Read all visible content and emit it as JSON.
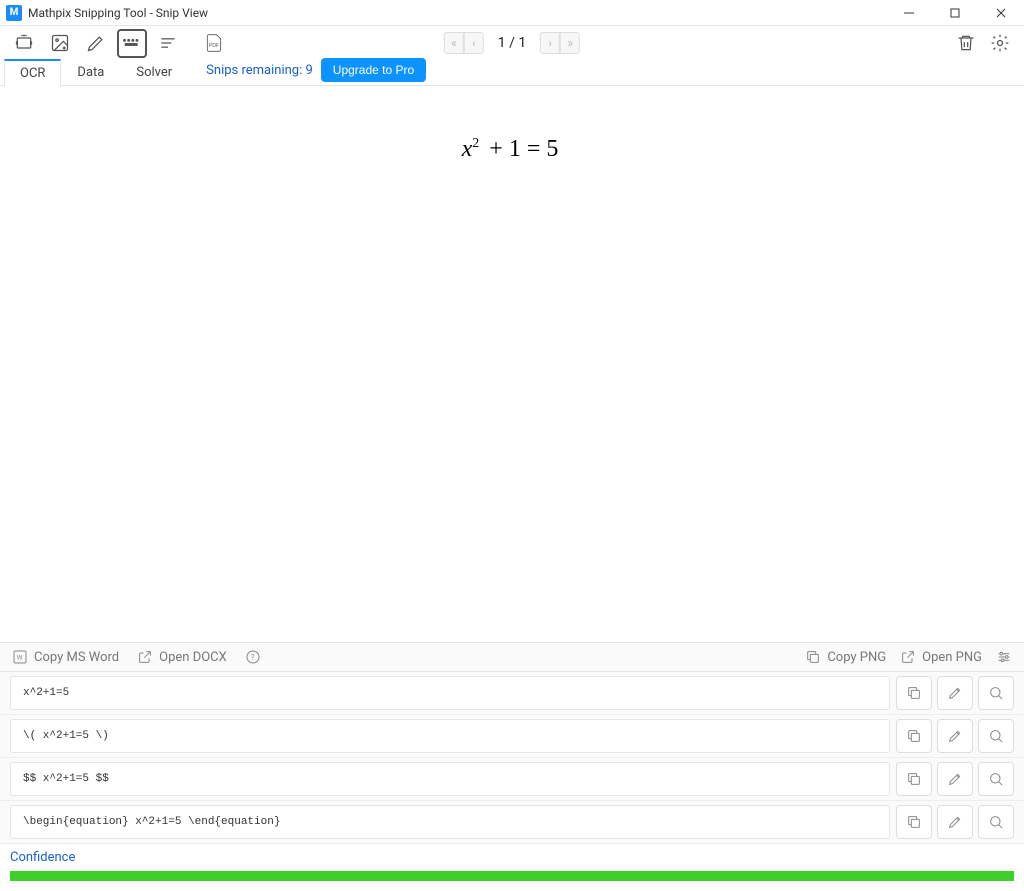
{
  "window": {
    "title": "Mathpix Snipping Tool - Snip View",
    "app_badge": "M"
  },
  "pager": {
    "current": "1",
    "total": "1",
    "display": "1 / 1"
  },
  "tabs": {
    "ocr": "OCR",
    "data": "Data",
    "solver": "Solver",
    "active": "OCR"
  },
  "snips": {
    "label": "Snips remaining:",
    "count": "9",
    "upgrade": "Upgrade to Pro"
  },
  "equation": {
    "base": "x",
    "exp": "2",
    "rest": " + 1 = 5"
  },
  "midbar": {
    "copy_word": "Copy MS Word",
    "open_docx": "Open DOCX",
    "copy_png": "Copy PNG",
    "open_png": "Open PNG"
  },
  "outputs": [
    {
      "text": "x^2+1=5"
    },
    {
      "text": "\\( x^2+1=5 \\)"
    },
    {
      "text": "$$  x^2+1=5  $$"
    },
    {
      "text": "\\begin{equation}  x^2+1=5  \\end{equation}"
    }
  ],
  "confidence": {
    "label": "Confidence",
    "percent": 100
  },
  "colors": {
    "accent": "#1a8cff",
    "link": "#1a5fd0",
    "confidence": "#3ecf2a"
  }
}
